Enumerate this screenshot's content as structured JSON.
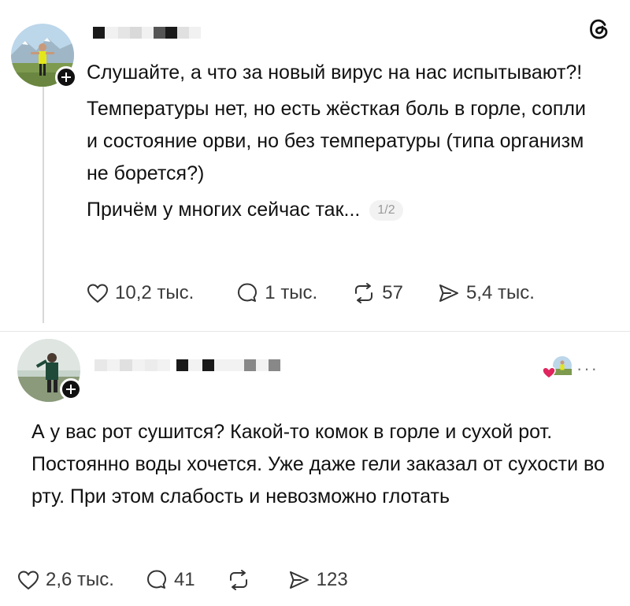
{
  "post": {
    "paragraphs": [
      "Слушайте, а что за новый вирус на нас испытывают?!",
      "Температуры нет, но есть жёсткая боль в горле, сопли и состояние орви, но без температуры (типа организм не борется?)",
      "Причём у многих сейчас так..."
    ],
    "page_counter": "1/2",
    "likes": "10,2 тыс.",
    "comments": "1 тыс.",
    "reposts": "57",
    "shares": "5,4 тыс."
  },
  "reply": {
    "text": "А у вас рот сушится? Какой-то комок в горле и сухой рот. Постоянно воды хочется. Уже даже гели заказал от сухости во рту. При этом слабость и невозможно глотать",
    "likes": "2,6 тыс.",
    "comments": "41",
    "reposts": "",
    "shares": "123",
    "more": "···"
  },
  "colors": {
    "text": "#111111",
    "muted": "#3a3a3a",
    "heart_red": "#e0245e",
    "divider": "#e6e6e6"
  },
  "icons": {
    "app_logo": "threads-logo-icon",
    "like": "heart-icon",
    "comment": "comment-icon",
    "repost": "repost-icon",
    "share": "send-icon",
    "follow": "plus-icon"
  }
}
